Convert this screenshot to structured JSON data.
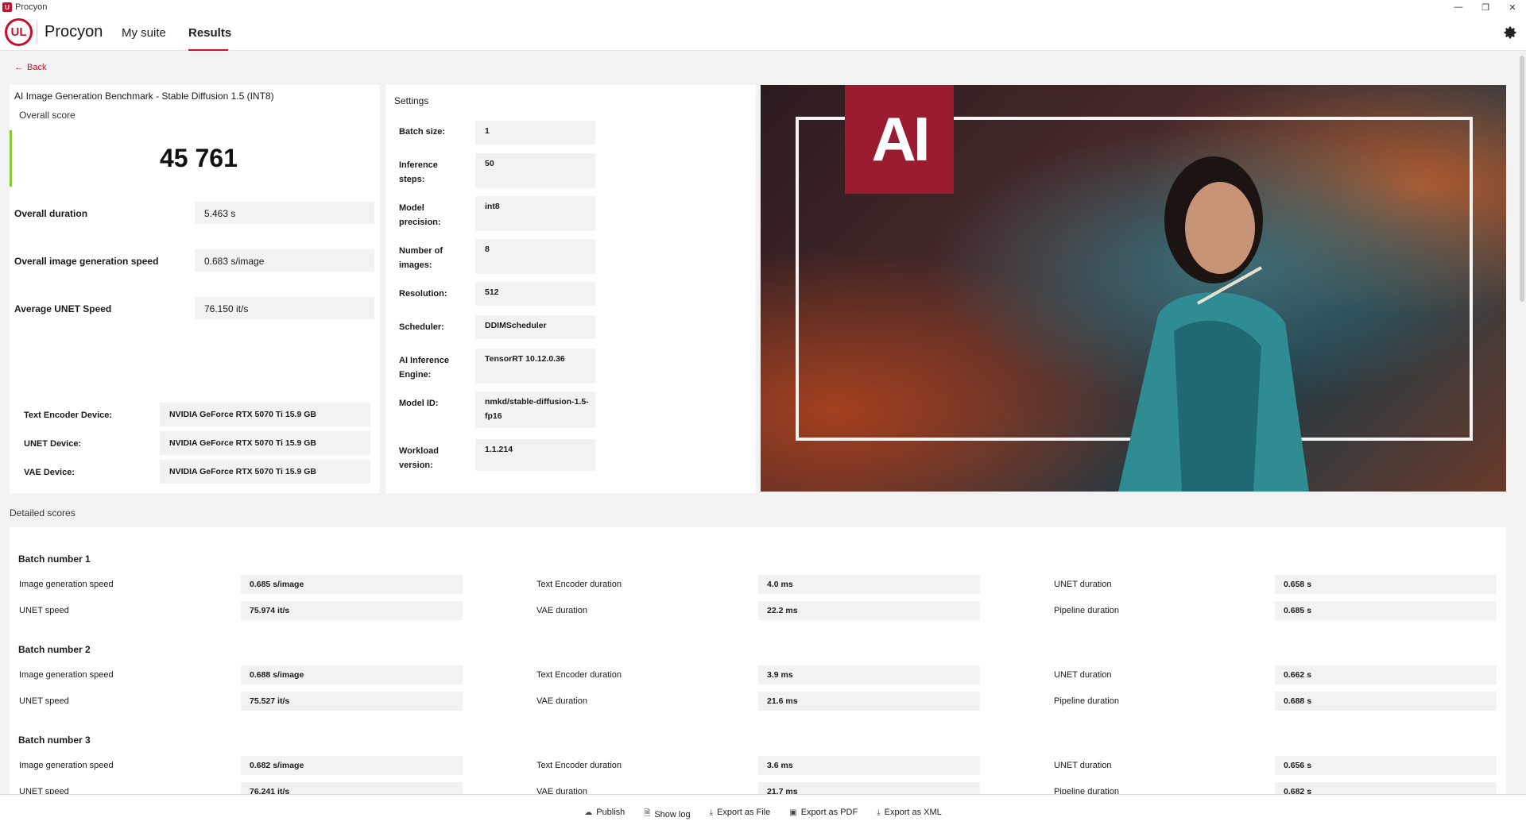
{
  "window": {
    "title": "Procyon",
    "controls": [
      "—",
      "❐",
      "✕"
    ]
  },
  "header": {
    "logo_text": "UL",
    "brand": "Procyon",
    "nav": [
      {
        "label": "My suite"
      },
      {
        "label": "Results"
      }
    ]
  },
  "back_label": "Back",
  "score_card": {
    "title": "AI Image Generation Benchmark - Stable Diffusion 1.5 (INT8)",
    "overall_label": "Overall score",
    "overall_score": "45 761",
    "metrics": [
      {
        "label": "Overall duration",
        "value": "5.463 s"
      },
      {
        "label": "Overall image generation speed",
        "value": "0.683 s/image"
      },
      {
        "label": "Average UNET Speed",
        "value": "76.150 it/s"
      }
    ],
    "devices": [
      {
        "label": "Text Encoder Device:",
        "value": "NVIDIA GeForce RTX 5070 Ti 15.9 GB"
      },
      {
        "label": "UNET Device:",
        "value": "NVIDIA GeForce RTX 5070 Ti 15.9 GB"
      },
      {
        "label": "VAE Device:",
        "value": "NVIDIA GeForce RTX 5070 Ti 15.9 GB"
      }
    ]
  },
  "settings": {
    "title": "Settings",
    "items": [
      {
        "label": "Batch size:",
        "value": "1"
      },
      {
        "label": "Inference steps:",
        "value": "50"
      },
      {
        "label": "Model precision:",
        "value": "int8"
      },
      {
        "label": "Number of images:",
        "value": "8"
      },
      {
        "label": "Resolution:",
        "value": "512"
      },
      {
        "label": "Scheduler:",
        "value": "DDIMScheduler"
      },
      {
        "label": "AI Inference Engine:",
        "value": "TensorRT 10.12.0.36"
      },
      {
        "label": "Model ID:",
        "value": "nmkd/stable-diffusion-1.5-fp16"
      },
      {
        "label": "Workload version:",
        "value": "1.1.214"
      }
    ]
  },
  "hero": {
    "logo_text": "AI"
  },
  "detailed": {
    "label": "Detailed scores",
    "batches": [
      {
        "title": "Batch number 1",
        "rows": [
          [
            {
              "label": "Image generation speed",
              "value": "0.685 s/image"
            },
            {
              "label": "Text Encoder duration",
              "value": "4.0 ms"
            },
            {
              "label": "UNET duration",
              "value": "0.658 s"
            }
          ],
          [
            {
              "label": "UNET speed",
              "value": "75.974 it/s"
            },
            {
              "label": "VAE duration",
              "value": "22.2 ms"
            },
            {
              "label": "Pipeline duration",
              "value": "0.685 s"
            }
          ]
        ]
      },
      {
        "title": "Batch number 2",
        "rows": [
          [
            {
              "label": "Image generation speed",
              "value": "0.688 s/image"
            },
            {
              "label": "Text Encoder duration",
              "value": "3.9 ms"
            },
            {
              "label": "UNET duration",
              "value": "0.662 s"
            }
          ],
          [
            {
              "label": "UNET speed",
              "value": "75.527 it/s"
            },
            {
              "label": "VAE duration",
              "value": "21.6 ms"
            },
            {
              "label": "Pipeline duration",
              "value": "0.688 s"
            }
          ]
        ]
      },
      {
        "title": "Batch number 3",
        "rows": [
          [
            {
              "label": "Image generation speed",
              "value": "0.682 s/image"
            },
            {
              "label": "Text Encoder duration",
              "value": "3.6 ms"
            },
            {
              "label": "UNET duration",
              "value": "0.656 s"
            }
          ],
          [
            {
              "label": "UNET speed",
              "value": "76.241 it/s"
            },
            {
              "label": "VAE duration",
              "value": "21.7 ms"
            },
            {
              "label": "Pipeline duration",
              "value": "0.682 s"
            }
          ]
        ]
      }
    ]
  },
  "footer": {
    "buttons": [
      {
        "label": "Publish",
        "icon": "cloud-upload-icon"
      },
      {
        "label": "Show log",
        "icon": "document-icon"
      },
      {
        "label": "Export as File",
        "icon": "download-icon"
      },
      {
        "label": "Export as PDF",
        "icon": "save-icon"
      },
      {
        "label": "Export as XML",
        "icon": "download-icon"
      }
    ]
  },
  "colors": {
    "accent": "#c8102e",
    "score_bar": "#8dc63f",
    "ai_logo_bg": "#9b1b30"
  }
}
